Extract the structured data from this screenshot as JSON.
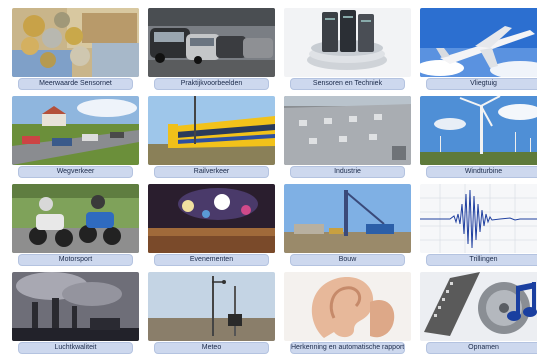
{
  "tiles": [
    {
      "label": "Meerwaarde Sensornet",
      "icon": "money-photo"
    },
    {
      "label": "Praktijkvoorbeelden",
      "icon": "cars-photo"
    },
    {
      "label": "Sensoren en Techniek",
      "icon": "servers-photo"
    },
    {
      "label": "Vliegtuig",
      "icon": "airplane-photo"
    },
    {
      "label": "Wegverkeer",
      "icon": "highway-photo"
    },
    {
      "label": "Railverkeer",
      "icon": "train-photo"
    },
    {
      "label": "Industrie",
      "icon": "industrial-roof-photo"
    },
    {
      "label": "Windturbine",
      "icon": "wind-turbine-photo"
    },
    {
      "label": "Motorsport",
      "icon": "motorcycle-race-photo"
    },
    {
      "label": "Evenementen",
      "icon": "concert-photo"
    },
    {
      "label": "Bouw",
      "icon": "construction-crane-photo"
    },
    {
      "label": "Trillingen",
      "icon": "vibration-waveform"
    },
    {
      "label": "Luchtkwaliteit",
      "icon": "smokestack-photo"
    },
    {
      "label": "Meteo",
      "icon": "weather-station-photo"
    },
    {
      "label": "Herkenning en automatische rapporten",
      "icon": "ear-photo"
    },
    {
      "label": "Opnamen",
      "icon": "film-reel-music-photo"
    }
  ]
}
